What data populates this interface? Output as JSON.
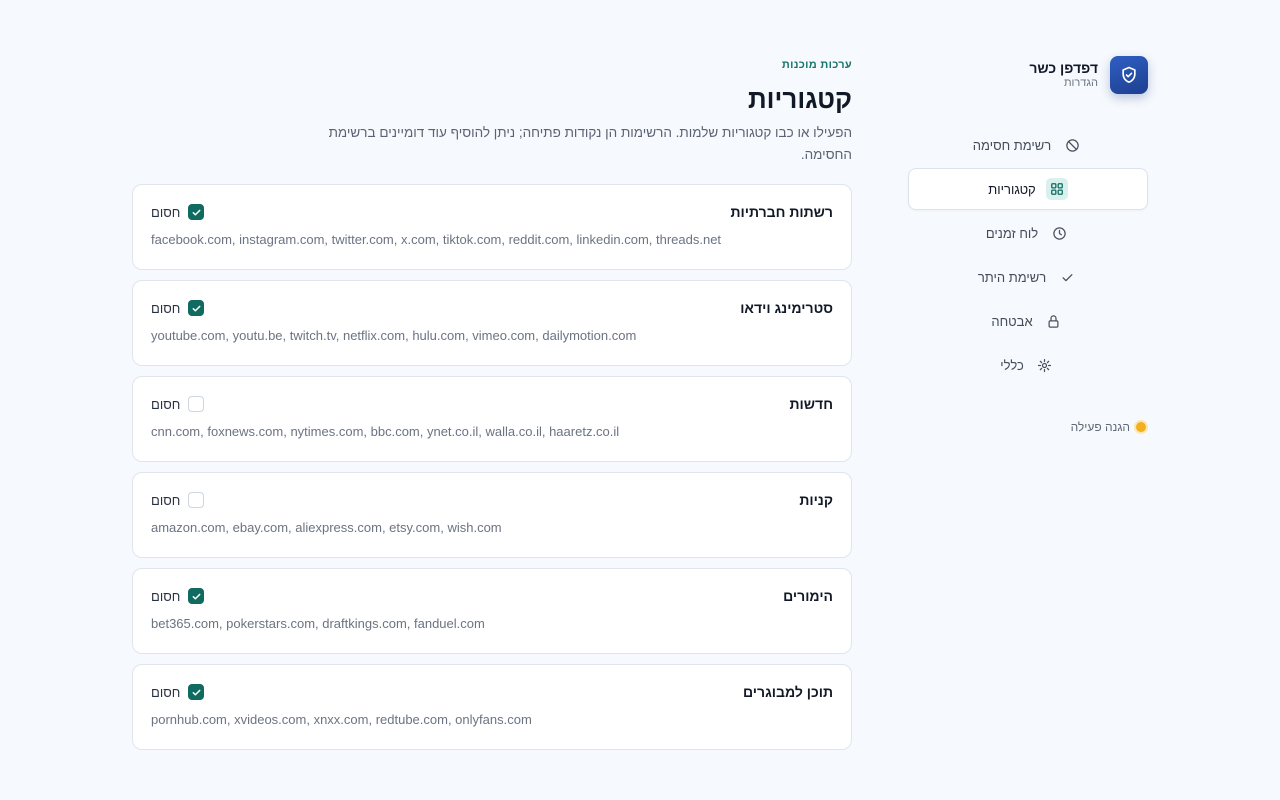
{
  "brand": {
    "title": "דפדפן כשר",
    "subtitle": "הגדרות",
    "icon": "shield-check-icon"
  },
  "nav": [
    {
      "key": "blocklist",
      "label": "רשימת חסימה",
      "icon": "ban-icon",
      "active": false
    },
    {
      "key": "categories",
      "label": "קטגוריות",
      "icon": "grid-icon",
      "active": true
    },
    {
      "key": "schedule",
      "label": "לוח זמנים",
      "icon": "clock-icon",
      "active": false
    },
    {
      "key": "allowlist",
      "label": "רשימת היתר",
      "icon": "check-icon",
      "active": false
    },
    {
      "key": "security",
      "label": "אבטחה",
      "icon": "lock-icon",
      "active": false
    },
    {
      "key": "general",
      "label": "כללי",
      "icon": "sun-gear-icon",
      "active": false
    }
  ],
  "status": {
    "label": "הגנה פעילה",
    "color": "#f2b01e"
  },
  "main": {
    "eyebrow": "ערכות מוכנות",
    "title": "קטגוריות",
    "description": "הפעילו או כבו קטגוריות שלמות. הרשימות הן נקודות פתיחה; ניתן להוסיף עוד דומיינים ברשימת החסימה."
  },
  "block_label": "חסום",
  "categories": [
    {
      "name": "רשתות חברתיות",
      "blocked": true,
      "domains": "facebook.com, instagram.com, twitter.com, x.com, tiktok.com, reddit.com, linkedin.com, threads.net"
    },
    {
      "name": "סטרימינג וידאו",
      "blocked": true,
      "domains": "youtube.com, youtu.be, twitch.tv, netflix.com, hulu.com, vimeo.com, dailymotion.com"
    },
    {
      "name": "חדשות",
      "blocked": false,
      "domains": "cnn.com, foxnews.com, nytimes.com, bbc.com, ynet.co.il, walla.co.il, haaretz.co.il"
    },
    {
      "name": "קניות",
      "blocked": false,
      "domains": "amazon.com, ebay.com, aliexpress.com, etsy.com, wish.com"
    },
    {
      "name": "הימורים",
      "blocked": true,
      "domains": "bet365.com, pokerstars.com, draftkings.com, fanduel.com"
    },
    {
      "name": "תוכן למבוגרים",
      "blocked": true,
      "domains": "pornhub.com, xvideos.com, xnxx.com, redtube.com, onlyfans.com"
    }
  ],
  "colors": {
    "accent": "#0f6b5f",
    "brand": "#1e3f8f",
    "background": "#f6f9fd"
  }
}
